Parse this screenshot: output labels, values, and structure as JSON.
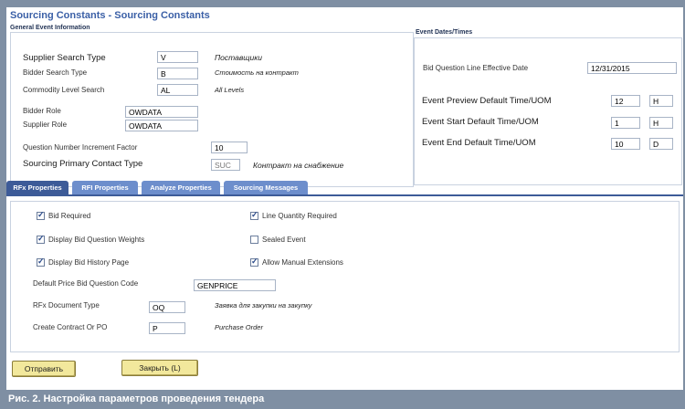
{
  "window": {
    "title": "Sourcing Constants - Sourcing Constants"
  },
  "general": {
    "heading": "General Event Information",
    "fields": [
      {
        "label": "Supplier Search Type",
        "value": "V",
        "note": "Поставщики"
      },
      {
        "label": "Bidder Search Type",
        "value": "B",
        "note": "Стоимость на контракт"
      },
      {
        "label": "Commodity Level Search",
        "value": "AL",
        "note": "All Levels"
      },
      {
        "label": "Bidder Role",
        "value": "OWDATA",
        "note": ""
      },
      {
        "label": "Supplier Role",
        "value": "OWDATA",
        "note": ""
      },
      {
        "label": "Question Number Increment Factor",
        "value": "10",
        "note": ""
      },
      {
        "label": "Sourcing Primary Contact Type",
        "value": "SUC",
        "note": "Контракт на снабжение"
      }
    ]
  },
  "event_dates": {
    "heading": "Event Dates/Times",
    "bid_due_label": "Bid Question Line Effective Date",
    "bid_due_value": "12/31/2015",
    "rows": [
      {
        "label": "Event Preview Default Time/UOM",
        "time": "12",
        "uom": "H"
      },
      {
        "label": "Event Start Default Time/UOM",
        "time": "1",
        "uom": "H"
      },
      {
        "label": "Event End Default Time/UOM",
        "time": "10",
        "uom": "D"
      }
    ]
  },
  "tabs": [
    {
      "label": "RFx Properties",
      "active": true
    },
    {
      "label": "RFI Properties",
      "active": false
    },
    {
      "label": "Analyze Properties",
      "active": false
    },
    {
      "label": "Sourcing Messages",
      "active": false
    }
  ],
  "rfx": {
    "checkboxes_left": [
      {
        "label": "Bid Required",
        "checked": true
      },
      {
        "label": "Display Bid Question Weights",
        "checked": true
      },
      {
        "label": "Display Bid History Page",
        "checked": true
      }
    ],
    "checkboxes_right": [
      {
        "label": "Line Quantity Required",
        "checked": true
      },
      {
        "label": "Sealed Event",
        "checked": false
      },
      {
        "label": "Allow Manual Extensions",
        "checked": true
      }
    ],
    "default_price_label": "Default Price Bid Question Code",
    "default_price_value": "GENPRICE",
    "doc_type_label": "RFx Document Type",
    "doc_type_value": "OQ",
    "doc_type_note": "Заявка для закупки на закупку",
    "create_label": "Create Contract Or PO",
    "create_value": "P",
    "create_note": "Purchase Order"
  },
  "buttons": {
    "submit": "Отправить",
    "close": "Закрыть (L)"
  },
  "caption": "Рис. 2. Настройка параметров проведения тендера"
}
